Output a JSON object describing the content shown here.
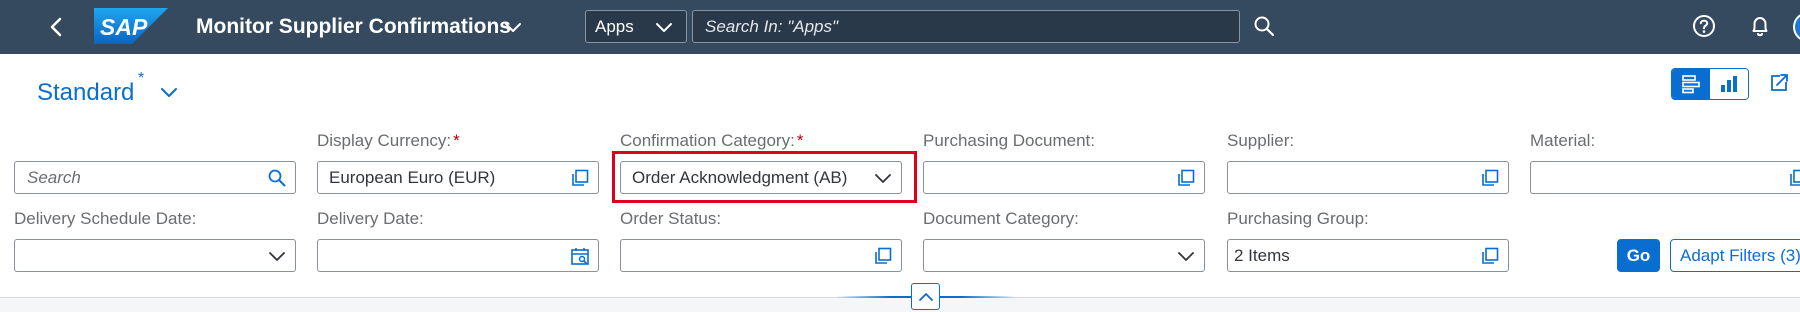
{
  "shell": {
    "app_title": "Monitor Supplier Confirmations",
    "logo_text": "SAP",
    "scope_label": "Apps",
    "search_placeholder": "Search In: \"Apps\"",
    "icons": [
      "back-icon",
      "chevron-down-icon",
      "search-icon",
      "help-icon",
      "bell-icon"
    ]
  },
  "header": {
    "variant_name": "Standard",
    "variant_modified_marker": "*",
    "view_toggle": [
      "compact-filter-icon",
      "chart-view-icon"
    ],
    "share_icon": "share-icon"
  },
  "filters": {
    "search_placeholder": "Search",
    "display_currency": {
      "label": "Display Currency:",
      "required": "*",
      "value": "European Euro (EUR)"
    },
    "confirmation_category": {
      "label": "Confirmation Category:",
      "required": "*",
      "value": "Order Acknowledgment (AB)"
    },
    "purchasing_document": {
      "label": "Purchasing Document:",
      "value": ""
    },
    "supplier": {
      "label": "Supplier:",
      "value": ""
    },
    "material": {
      "label": "Material:",
      "value": ""
    },
    "delivery_schedule_date": {
      "label": "Delivery Schedule Date:",
      "value": ""
    },
    "delivery_date": {
      "label": "Delivery Date:",
      "value": ""
    },
    "order_status": {
      "label": "Order Status:",
      "value": ""
    },
    "document_category": {
      "label": "Document Category:",
      "value": ""
    },
    "purchasing_group": {
      "label": "Purchasing Group:",
      "value": "2 Items"
    }
  },
  "actions": {
    "go_label": "Go",
    "adapt_filters_label": "Adapt Filters (3)"
  },
  "colors": {
    "shell_bg": "#354a5f",
    "accent": "#0a6ed1",
    "required": "#bb0000",
    "highlight": "#e0001b"
  }
}
